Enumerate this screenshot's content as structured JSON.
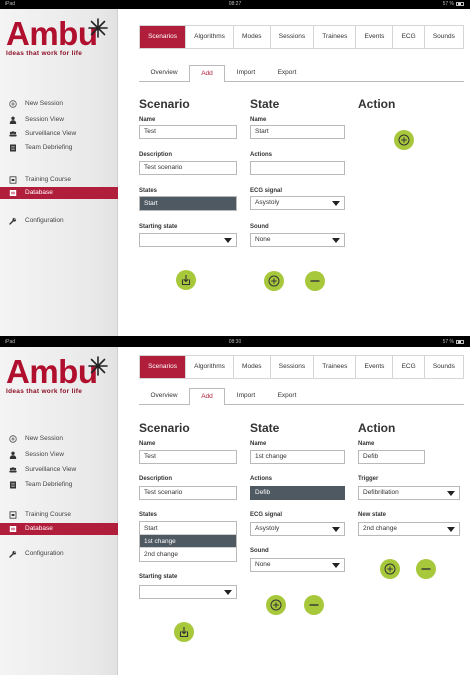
{
  "brand": {
    "logo": "Ambu",
    "tagline": "Ideas that work for life",
    "accent": "#b01e3b",
    "button_green": "#a8c83c"
  },
  "nav": [
    {
      "label": "New Session",
      "icon": "plus-circle-icon"
    },
    {
      "label": "Session View",
      "icon": "person-icon"
    },
    {
      "label": "Surveillance View",
      "icon": "group-icon"
    },
    {
      "label": "Team Debriefing",
      "icon": "document-icon"
    },
    {
      "label": "Training Course",
      "icon": "monitor-icon"
    },
    {
      "label": "Database",
      "icon": "database-icon"
    },
    {
      "label": "Configuration",
      "icon": "wrench-icon"
    }
  ],
  "tabs": [
    "Scenarios",
    "Algorithms",
    "Modes",
    "Sessions",
    "Trainees",
    "Events",
    "ECG",
    "Sounds"
  ],
  "subtabs": [
    "Overview",
    "Add",
    "Import",
    "Export"
  ],
  "screen1": {
    "status": {
      "left": "iPad",
      "time": "08:27",
      "right": "57 %"
    },
    "scenario": {
      "title": "Scenario",
      "name_label": "Name",
      "name_value": "Test",
      "description_label": "Description",
      "description_value": "Test scenario",
      "states_label": "States",
      "states": [
        "Start"
      ],
      "starting_state_label": "Starting state",
      "starting_state_value": ""
    },
    "state": {
      "title": "State",
      "name_label": "Name",
      "name_value": "Start",
      "actions_label": "Actions",
      "actions": [
        ""
      ],
      "ecg_label": "ECG signal",
      "ecg_value": "Asystoly",
      "sound_label": "Sound",
      "sound_value": "None"
    },
    "action": {
      "title": "Action"
    }
  },
  "screen2": {
    "status": {
      "left": "iPad",
      "time": "08:30",
      "right": "57 %"
    },
    "scenario": {
      "title": "Scenario",
      "name_label": "Name",
      "name_value": "Test",
      "description_label": "Description",
      "description_value": "Test scenario",
      "states_label": "States",
      "states": [
        "Start",
        "1st change",
        "2nd change"
      ],
      "starting_state_label": "Starting state",
      "starting_state_value": ""
    },
    "state": {
      "title": "State",
      "name_label": "Name",
      "name_value": "1st change",
      "actions_label": "Actions",
      "actions": [
        "Defib"
      ],
      "ecg_label": "ECG signal",
      "ecg_value": "Asystoly",
      "sound_label": "Sound",
      "sound_value": "None"
    },
    "action": {
      "title": "Action",
      "name_label": "Name",
      "name_value": "Defib",
      "trigger_label": "Trigger",
      "trigger_value": "Defibrillation",
      "new_state_label": "New state",
      "new_state_value": "2nd change"
    }
  }
}
